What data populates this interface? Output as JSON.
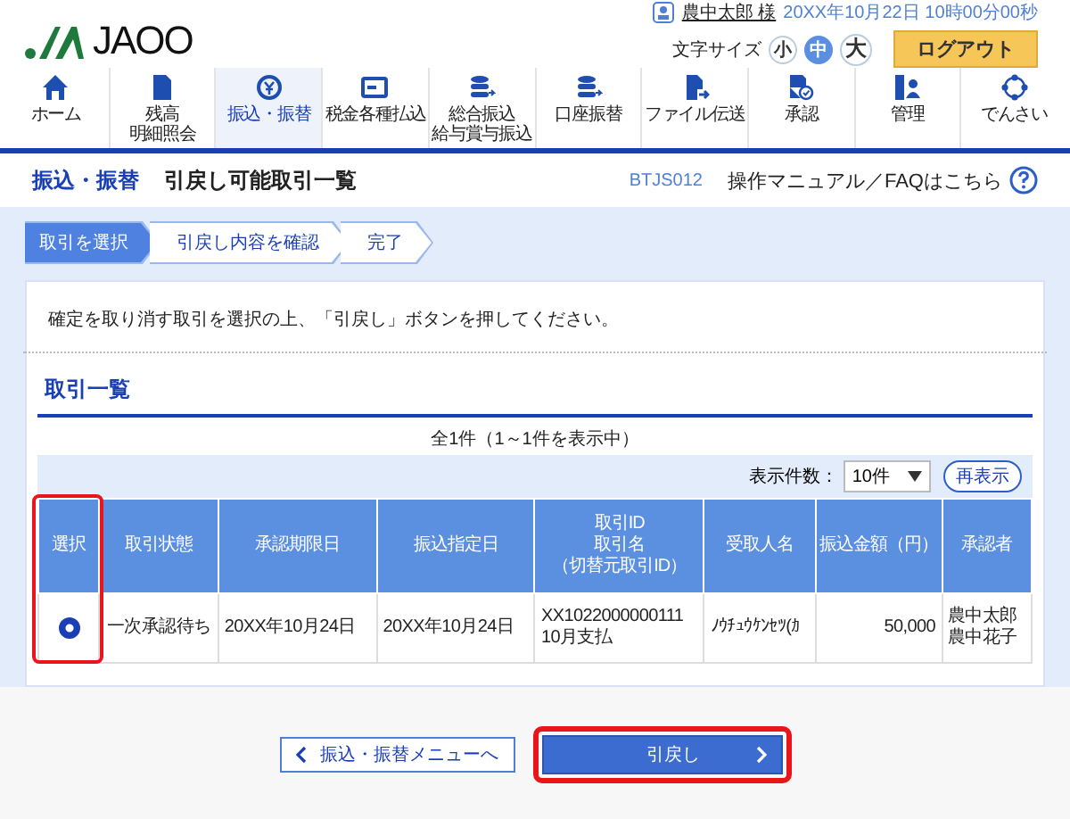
{
  "header": {
    "logo": "JAOO",
    "user_name": "農中太郎 様",
    "login_time": "20XX年10月22日 10時00分00秒",
    "font_size_label": "文字サイズ",
    "font_sizes": [
      {
        "label": "小",
        "selected": false
      },
      {
        "label": "中",
        "selected": true
      },
      {
        "label": "大",
        "selected": false
      }
    ],
    "logout": "ログアウト"
  },
  "nav": {
    "items": [
      {
        "label": "ホーム",
        "selected": false
      },
      {
        "label": [
          "残高",
          "明細照会"
        ],
        "selected": false
      },
      {
        "label": "振込・振替",
        "selected": true
      },
      {
        "label": "税金各種払込",
        "selected": false
      },
      {
        "label": [
          "総合振込",
          "給与賞与振込"
        ],
        "selected": false
      },
      {
        "label": "口座振替",
        "selected": false
      },
      {
        "label": "ファイル伝送",
        "selected": false
      },
      {
        "label": "承認",
        "selected": false
      },
      {
        "label": "管理",
        "selected": false
      },
      {
        "label": "でんさい",
        "selected": false
      }
    ]
  },
  "title_bar": {
    "section": "振込・振替",
    "title": "引戻し可能取引一覧",
    "screen_id": "BTJS012",
    "help_link": "操作マニュアル／FAQはこちら"
  },
  "steps": [
    {
      "label": "取引を選択",
      "selected": true
    },
    {
      "label": "引戻し内容を確認",
      "selected": false
    },
    {
      "label": "完了",
      "selected": false
    }
  ],
  "message": "確定を取り消す取引を選択の上、「引戻し」ボタンを押してください。",
  "list": {
    "heading": "取引一覧",
    "count": "全1件（1～1件を表示中）",
    "page_size_label": "表示件数：",
    "page_size": "10件",
    "refresh": "再表示",
    "select_column_highlighted": true,
    "columns": [
      "選択",
      "取引状態",
      "承認期限日",
      "振込指定日",
      [
        "取引ID",
        "取引名",
        "（切替元取引ID）"
      ],
      "受取人名",
      "振込金額（円）",
      "承認者"
    ],
    "rows": [
      {
        "selected": true,
        "cells": [
          "",
          "一次承認待ち",
          "20XX年10月24日",
          "20XX年10月24日",
          [
            "XX1022000000111",
            "10月支払"
          ],
          "ﾉｳﾁｭｳｹﾝｾﾂ(ｶ",
          "50,000",
          [
            "農中太郎",
            "農中花子"
          ]
        ]
      }
    ]
  },
  "buttons": [
    {
      "label": "振込・振替メニューへ",
      "kind": "back",
      "highlighted": false
    },
    {
      "label": "引戻し",
      "kind": "primary",
      "highlighted": true
    }
  ]
}
